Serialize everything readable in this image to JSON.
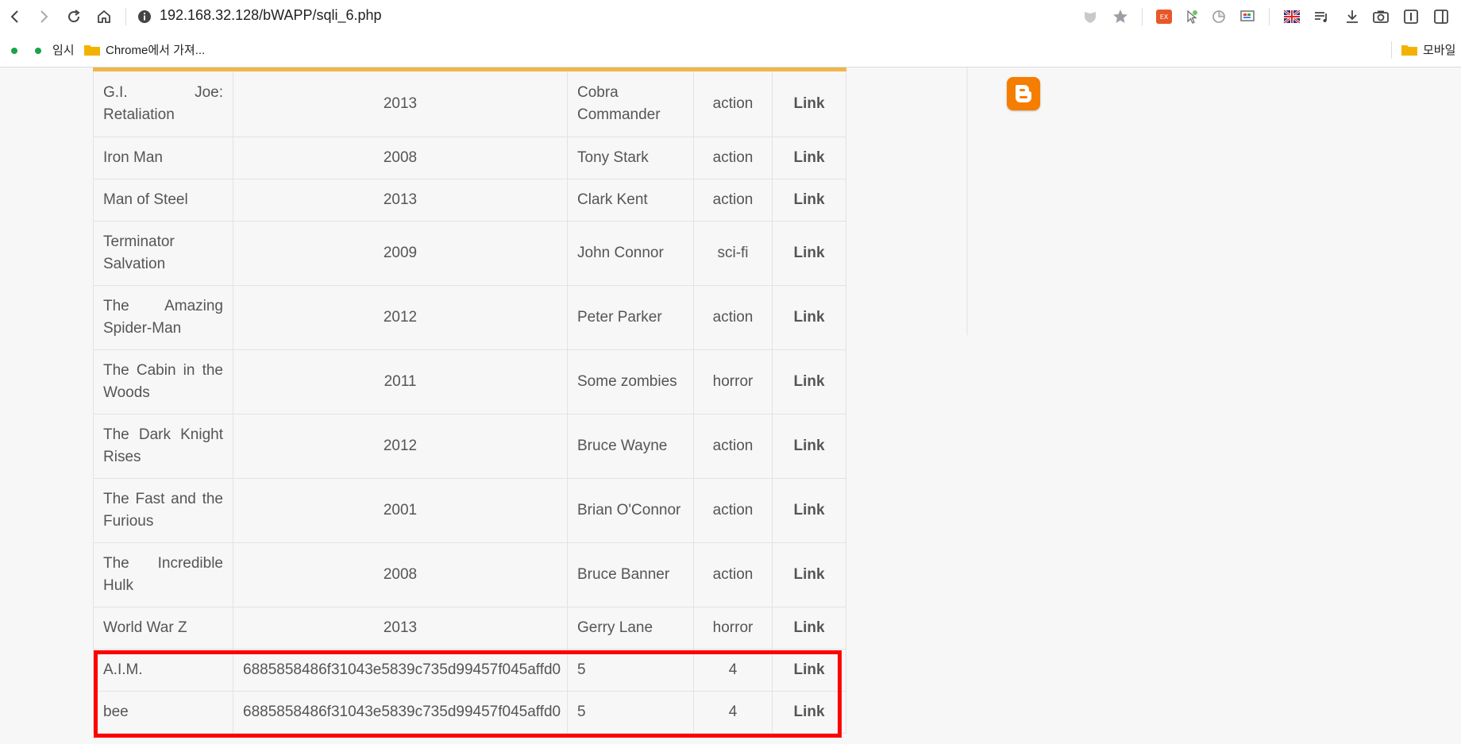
{
  "browser": {
    "url": "192.168.32.128/bWAPP/sqli_6.php",
    "accent": "#1a73e8"
  },
  "bookmarks": {
    "items": [
      "임시",
      "Chrome에서 가져..."
    ],
    "right_folder": "모바일"
  },
  "colors": {
    "header_bar": "#f0b64a",
    "highlight_box": "#ff0000",
    "blogger": "#f57d00"
  },
  "table": {
    "rows": [
      {
        "title": "G.I. Joe: Retaliation",
        "year": "2013",
        "character": "Cobra Commander",
        "genre": "action",
        "link": "Link"
      },
      {
        "title": "Iron Man",
        "year": "2008",
        "character": "Tony Stark",
        "genre": "action",
        "link": "Link"
      },
      {
        "title": "Man of Steel",
        "year": "2013",
        "character": "Clark Kent",
        "genre": "action",
        "link": "Link"
      },
      {
        "title": "Terminator Salvation",
        "year": "2009",
        "character": "John Connor",
        "genre": "sci-fi",
        "link": "Link"
      },
      {
        "title": "The Amazing Spider-Man",
        "year": "2012",
        "character": "Peter Parker",
        "genre": "action",
        "link": "Link"
      },
      {
        "title": "The Cabin in the Woods",
        "year": "2011",
        "character": "Some zombies",
        "genre": "horror",
        "link": "Link"
      },
      {
        "title": "The Dark Knight Rises",
        "year": "2012",
        "character": "Bruce Wayne",
        "genre": "action",
        "link": "Link"
      },
      {
        "title": "The Fast and the Furious",
        "year": "2001",
        "character": "Brian O'Connor",
        "genre": "action",
        "link": "Link"
      },
      {
        "title": "The Incredible Hulk",
        "year": "2008",
        "character": "Bruce Banner",
        "genre": "action",
        "link": "Link"
      },
      {
        "title": "World War Z",
        "year": "2013",
        "character": "Gerry Lane",
        "genre": "horror",
        "link": "Link"
      },
      {
        "title": "A.I.M.",
        "year": "6885858486f31043e5839c735d99457f045affd0",
        "character": "5",
        "genre": "4",
        "link": "Link"
      },
      {
        "title": "bee",
        "year": "6885858486f31043e5839c735d99457f045affd0",
        "character": "5",
        "genre": "4",
        "link": "Link"
      }
    ]
  }
}
